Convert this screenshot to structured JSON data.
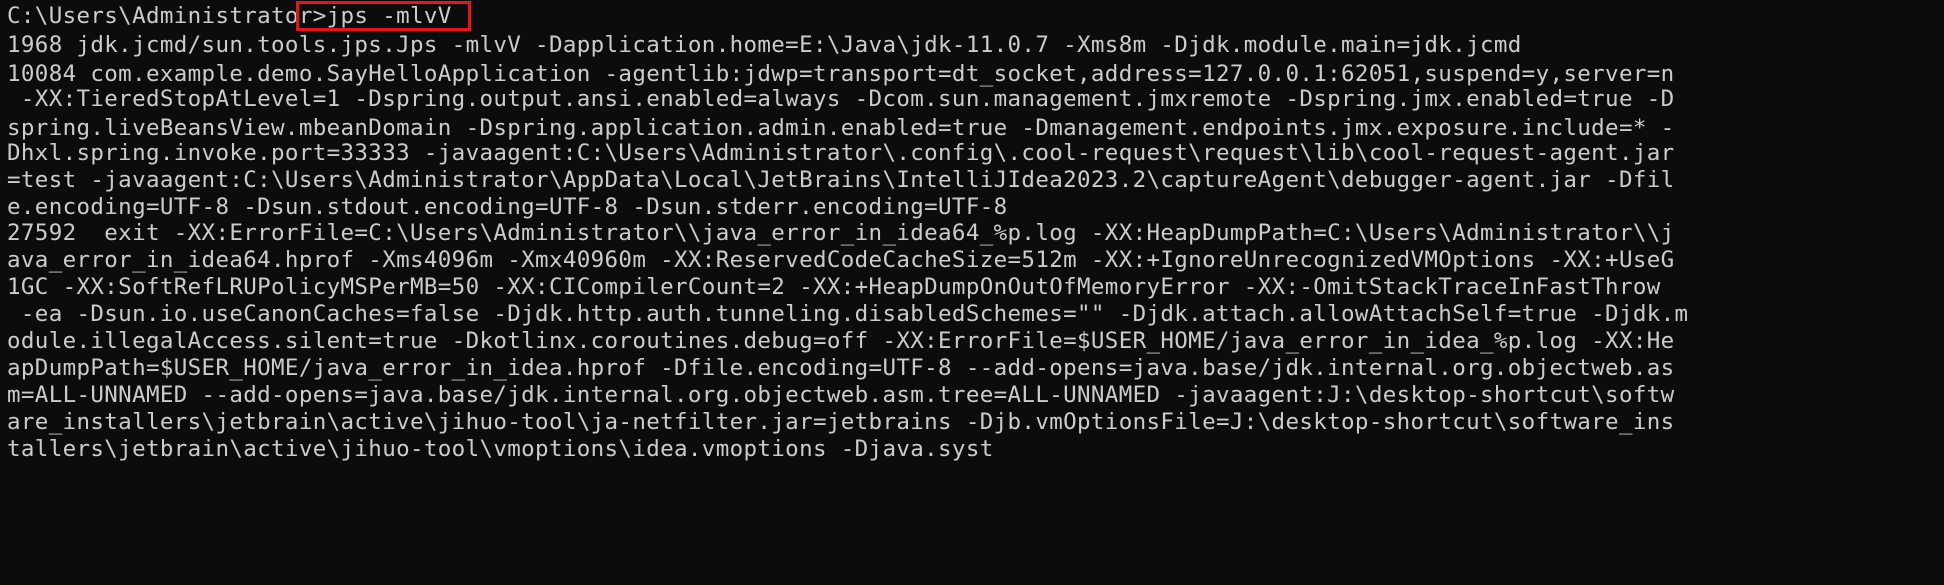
{
  "terminal": {
    "prompt_path": "C:\\Users\\Administrator>",
    "command": "jps -mlvV",
    "highlight_color": "#e8141c",
    "background_color": "#0c0c0c",
    "text_color": "#cccccc",
    "output_lines": [
      "1968 jdk.jcmd/sun.tools.jps.Jps -mlvV -Dapplication.home=E:\\Java\\jdk-11.0.7 -Xms8m -Djdk.module.main=jdk.jcmd",
      "10084 com.example.demo.SayHelloApplication -agentlib:jdwp=transport=dt_socket,address=127.0.0.1:62051,suspend=y,server=n",
      " -XX:TieredStopAtLevel=1 -Dspring.output.ansi.enabled=always -Dcom.sun.management.jmxremote -Dspring.jmx.enabled=true -D",
      "spring.liveBeansView.mbeanDomain -Dspring.application.admin.enabled=true -Dmanagement.endpoints.jmx.exposure.include=* -",
      "Dhxl.spring.invoke.port=33333 -javaagent:C:\\Users\\Administrator\\.config\\.cool-request\\request\\lib\\cool-request-agent.jar",
      "=test -javaagent:C:\\Users\\Administrator\\AppData\\Local\\JetBrains\\IntelliJIdea2023.2\\captureAgent\\debugger-agent.jar -Dfil",
      "e.encoding=UTF-8 -Dsun.stdout.encoding=UTF-8 -Dsun.stderr.encoding=UTF-8",
      "27592  exit -XX:ErrorFile=C:\\Users\\Administrator\\\\java_error_in_idea64_%p.log -XX:HeapDumpPath=C:\\Users\\Administrator\\\\j",
      "ava_error_in_idea64.hprof -Xms4096m -Xmx40960m -XX:ReservedCodeCacheSize=512m -XX:+IgnoreUnrecognizedVMOptions -XX:+UseG",
      "1GC -XX:SoftRefLRUPolicyMSPerMB=50 -XX:CICompilerCount=2 -XX:+HeapDumpOnOutOfMemoryError -XX:-OmitStackTraceInFastThrow",
      " -ea -Dsun.io.useCanonCaches=false -Djdk.http.auth.tunneling.disabledSchemes=\"\" -Djdk.attach.allowAttachSelf=true -Djdk.m",
      "odule.illegalAccess.silent=true -Dkotlinx.coroutines.debug=off -XX:ErrorFile=$USER_HOME/java_error_in_idea_%p.log -XX:He",
      "apDumpPath=$USER_HOME/java_error_in_idea.hprof -Dfile.encoding=UTF-8 --add-opens=java.base/jdk.internal.org.objectweb.as",
      "m=ALL-UNNAMED --add-opens=java.base/jdk.internal.org.objectweb.asm.tree=ALL-UNNAMED -javaagent:J:\\desktop-shortcut\\softw",
      "are_installers\\jetbrain\\active\\jihuo-tool\\ja-netfilter.jar=jetbrains -Djb.vmOptionsFile=J:\\desktop-shortcut\\software_ins",
      "tallers\\jetbrain\\active\\jihuo-tool\\vmoptions\\idea.vmoptions -Djava.syst"
    ]
  }
}
